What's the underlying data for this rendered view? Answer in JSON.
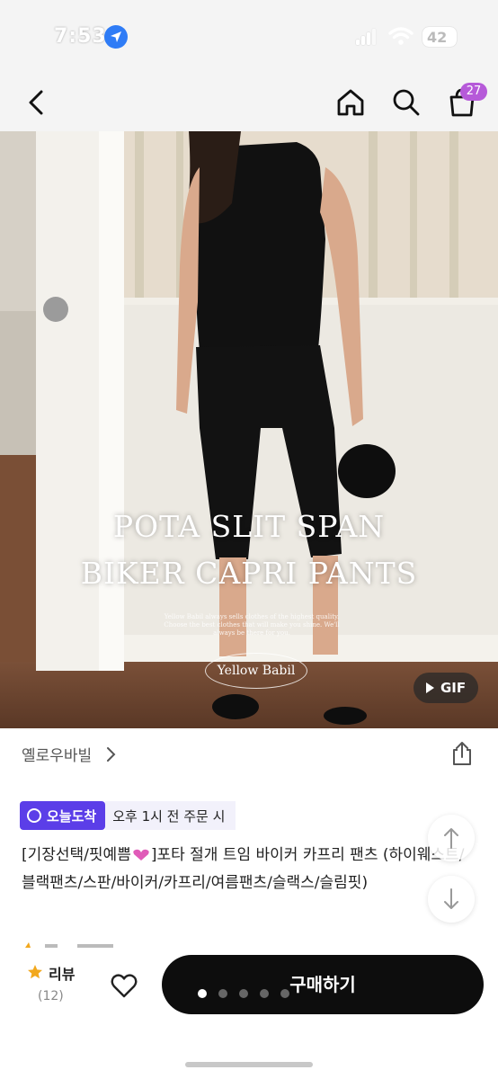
{
  "status_bar": {
    "time": "7:53",
    "battery": "42"
  },
  "header": {
    "cart_count": "27"
  },
  "product_image": {
    "title_line1": "POTA SLIT SPAN",
    "title_line2": "BIKER CAPRI PANTS",
    "tagline": "Yellow Babil always sells clothes of the highest quality. Choose the best clothes that will make you shine. We'll always be there for you.",
    "brand_mark": "Yellow Babil",
    "gif_label": "GIF"
  },
  "seller": {
    "name": "옐로우바빌"
  },
  "delivery": {
    "badge_label": "오늘도착",
    "note": "오후 1시 전 주문 시"
  },
  "product": {
    "title_part1": "[기장선택/핏예쁨",
    "title_part2": "]포타 절개 트임 바이커 카프리 팬츠 (하이웨스트/블랙팬츠/스판/바이커/카프리/여름팬츠/슬랙스/슬림핏)"
  },
  "bottom_bar": {
    "review_label": "리뷰",
    "review_count": "(12)",
    "buy_label": "구매하기"
  },
  "colors": {
    "delivery_badge": "#5b3ee8",
    "cart_badge": "#b65ad9",
    "buy_button": "#0d0d0d",
    "star": "#f2a81d"
  },
  "icons": [
    "location-arrow-icon",
    "signal-icon",
    "wifi-icon",
    "battery-icon",
    "back-icon",
    "home-icon",
    "search-icon",
    "cart-icon",
    "play-icon",
    "chevron-right-icon",
    "share-icon",
    "arrow-circle-icon",
    "heart-emoji-icon",
    "arrow-up-icon",
    "arrow-down-icon",
    "star-icon",
    "heart-icon"
  ]
}
